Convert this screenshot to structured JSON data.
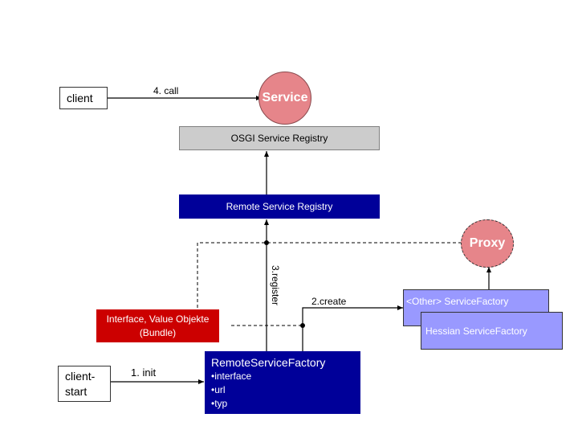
{
  "nodes": {
    "client": "client",
    "client_start": "client-\nstart",
    "client_start_line1": "client-",
    "client_start_line2": "start",
    "service": "Service",
    "osgi_registry": "OSGI Service Registry",
    "remote_registry": "Remote Service Registry",
    "proxy": "Proxy",
    "interface_bundle_line1": "Interface, Value Objekte",
    "interface_bundle_line2": "(Bundle)",
    "other_factory": "<Other> ServiceFactory",
    "hessian_factory": "Hessian ServiceFactory",
    "remote_service_factory": {
      "title": "RemoteServiceFactory",
      "attributes": [
        "interface",
        "url",
        "typ"
      ]
    }
  },
  "edges": {
    "init": "1. init",
    "create": "2.create",
    "register": "3.register",
    "call": "4. call"
  },
  "colors": {
    "service_circle": "#e6858a",
    "navy": "#000099",
    "red": "#cc0000",
    "factory": "#9999ff",
    "gray": "#cccccc"
  }
}
